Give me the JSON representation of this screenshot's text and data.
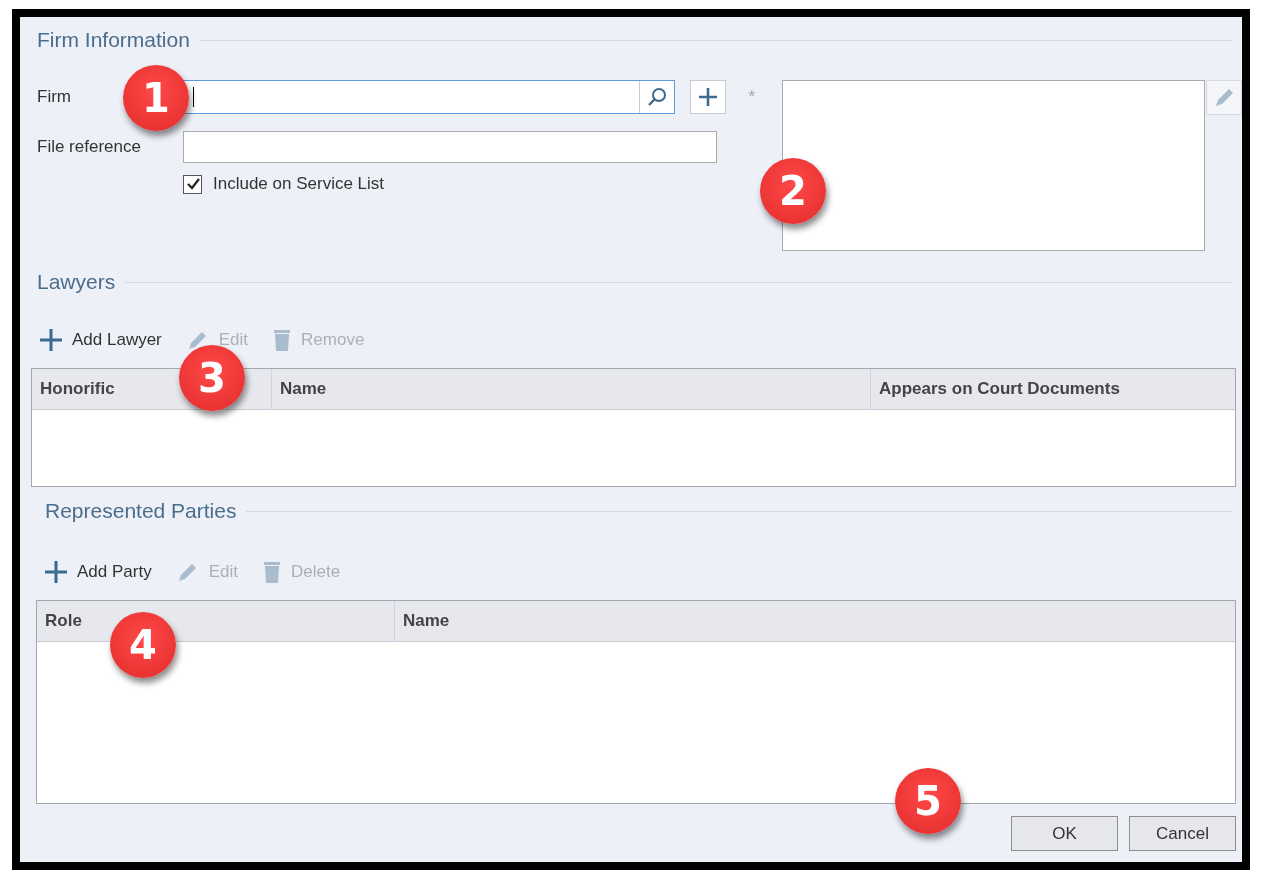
{
  "firm_information": {
    "heading": "Firm Information",
    "firm": {
      "label": "Firm",
      "focused": true,
      "required_mark": "*"
    },
    "file_reference": {
      "label": "File reference"
    },
    "include_on_service_list": {
      "label": "Include on Service List",
      "checked": true
    }
  },
  "lawyers": {
    "heading": "Lawyers",
    "toolbar": [
      {
        "kind": "add",
        "label": "Add Lawyer",
        "disabled": false
      },
      {
        "kind": "edit",
        "label": "Edit",
        "disabled": true
      },
      {
        "kind": "delete",
        "label": "Remove",
        "disabled": true
      }
    ],
    "table": {
      "columns": [
        "Honorific",
        "Name",
        "Appears on Court Documents"
      ]
    }
  },
  "represented_parties": {
    "heading": "Represented Parties",
    "toolbar": [
      {
        "kind": "add",
        "label": "Add Party",
        "disabled": false
      },
      {
        "kind": "edit",
        "label": "Edit",
        "disabled": true
      },
      {
        "kind": "delete",
        "label": "Delete",
        "disabled": true
      }
    ],
    "table": {
      "columns": [
        "Role",
        "Name"
      ]
    }
  },
  "buttons": [
    "OK",
    "Cancel"
  ],
  "callouts": [
    "1",
    "2",
    "3",
    "4",
    "5"
  ]
}
